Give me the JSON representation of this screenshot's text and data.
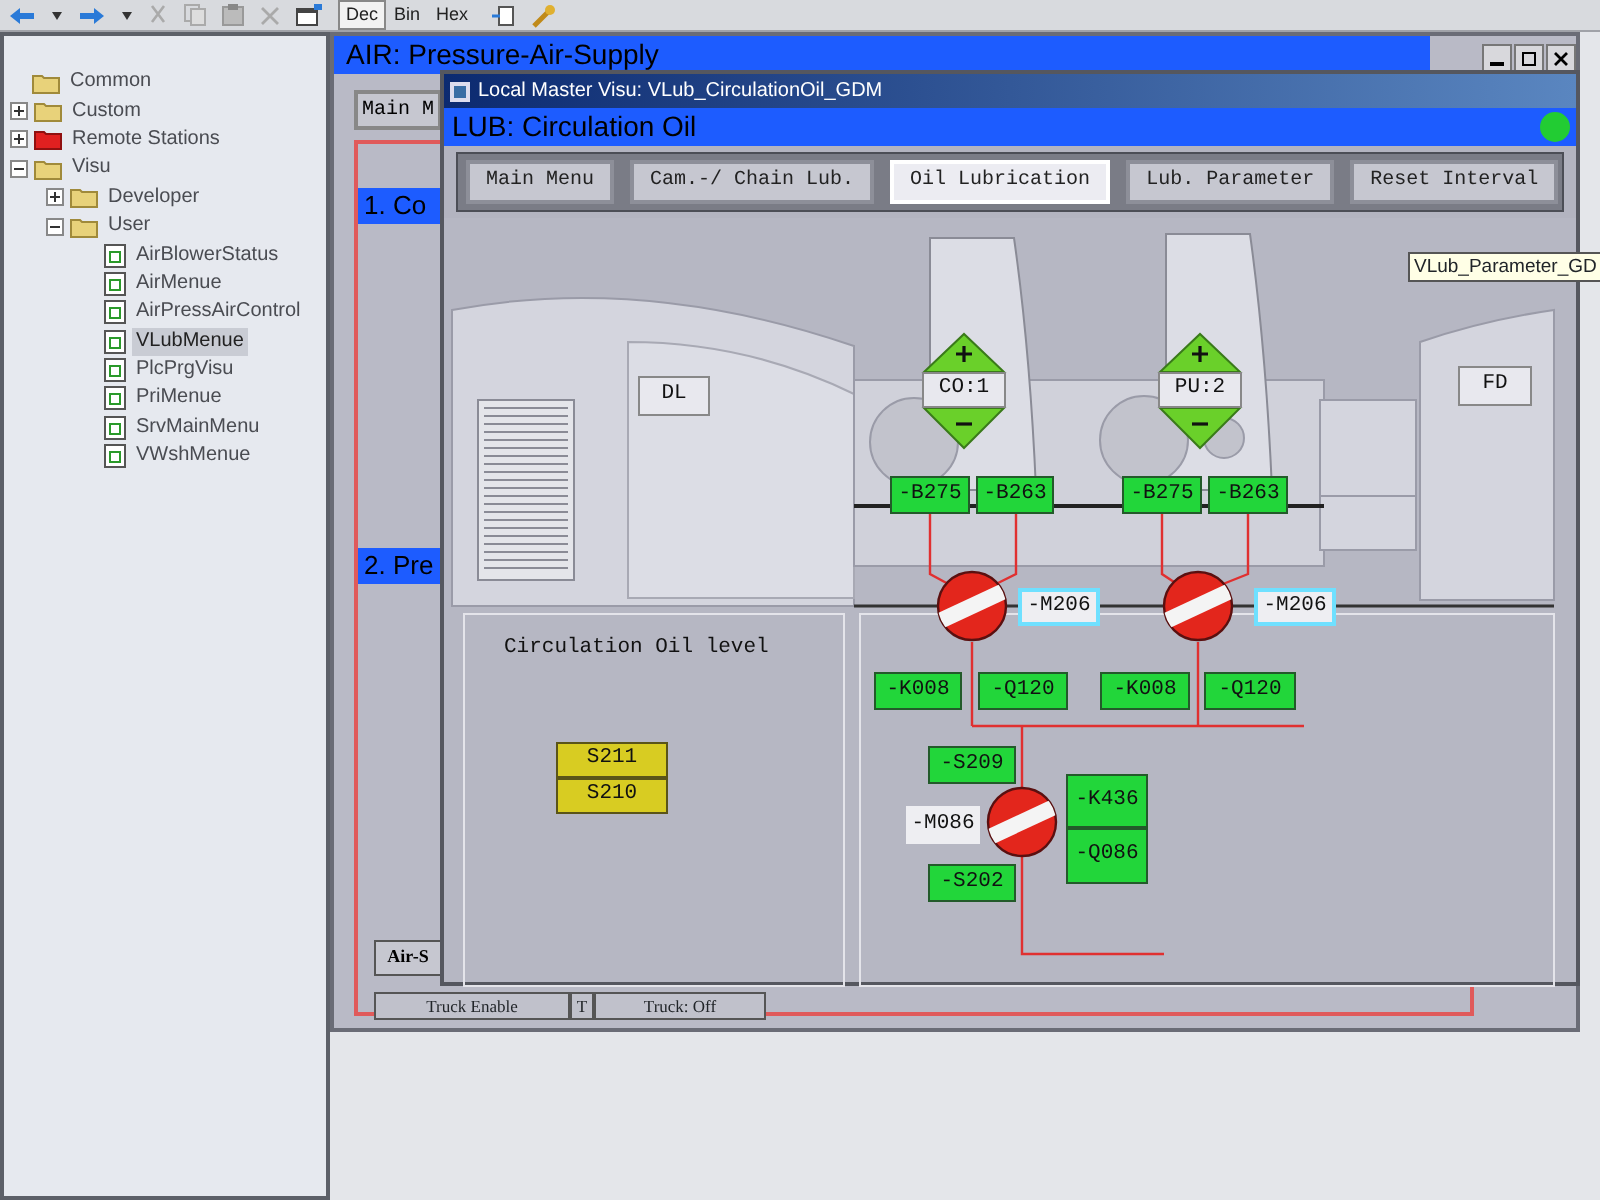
{
  "toolbar": {
    "modes": [
      {
        "label": "Dec",
        "selected": true
      },
      {
        "label": "Bin",
        "selected": false
      },
      {
        "label": "Hex",
        "selected": false
      }
    ]
  },
  "tree": [
    {
      "label": "Common",
      "kind": "folder",
      "selected": false
    },
    {
      "label": "Custom",
      "kind": "folder",
      "expanded": false,
      "selected": false
    },
    {
      "label": "Remote Stations",
      "kind": "remote-folder",
      "expanded": false,
      "selected": false
    },
    {
      "label": "Visu",
      "kind": "folder",
      "expanded": true,
      "selected": false,
      "children": [
        {
          "label": "Developer",
          "kind": "folder",
          "expanded": false,
          "selected": false
        },
        {
          "label": "User",
          "kind": "folder",
          "expanded": true,
          "selected": false,
          "children": [
            {
              "label": "AirBlowerStatus",
              "kind": "file",
              "selected": false
            },
            {
              "label": "AirMenue",
              "kind": "file",
              "selected": false
            },
            {
              "label": "AirPressAirControl",
              "kind": "file",
              "selected": false
            },
            {
              "label": "VLubMenue",
              "kind": "file",
              "selected": true
            },
            {
              "label": "PlcPrgVisu",
              "kind": "file",
              "selected": false
            },
            {
              "label": "PriMenue",
              "kind": "file",
              "selected": false
            },
            {
              "label": "SrvMainMenu",
              "kind": "file",
              "selected": false
            },
            {
              "label": "VWshMenue",
              "kind": "file",
              "selected": false
            }
          ]
        }
      ]
    }
  ],
  "back_window": {
    "title": "AIR: Pressure-Air-Supply",
    "menu_button": "Main M",
    "sections": [
      "1. Co",
      "2. Pre"
    ],
    "bottom_button": "Air-S",
    "status_cells": [
      "Truck Enable",
      "T",
      "Truck: Off"
    ]
  },
  "front_window": {
    "title": "Local Master Visu: VLub_CirculationOil_GDM",
    "header": "LUB: Circulation Oil",
    "status_on": true,
    "tabs": [
      {
        "label": "Main Menu",
        "selected": false
      },
      {
        "label": "Cam.-/ Chain Lub.",
        "selected": false
      },
      {
        "label": "Oil Lubrication",
        "selected": true
      },
      {
        "label": "Lub. Parameter",
        "selected": false
      },
      {
        "label": "Reset Interval",
        "selected": false
      }
    ],
    "tooltip": "VLub_Parameter_GD",
    "diagram": {
      "machine_labels": [
        "DL",
        "FD"
      ],
      "selectors": [
        {
          "label": "CO:1"
        },
        {
          "label": "PU:2"
        }
      ],
      "top_sensors": [
        "-B275",
        "-B263",
        "-B275",
        "-B263"
      ],
      "motors": [
        {
          "label": "-M206",
          "kind": "framed"
        },
        {
          "label": "-M206",
          "kind": "framed"
        },
        {
          "label": "-M086",
          "kind": "plain"
        }
      ],
      "relays": [
        "-K008",
        "-Q120",
        "-K008",
        "-Q120"
      ],
      "switches": [
        "-S209",
        "-S202"
      ],
      "pump_contacts": [
        "-K436",
        "-Q086"
      ],
      "level_panel": {
        "title": "Circulation Oil level",
        "switches": [
          {
            "label": "S211",
            "on": true
          },
          {
            "label": "S210",
            "on": true
          }
        ]
      }
    }
  }
}
